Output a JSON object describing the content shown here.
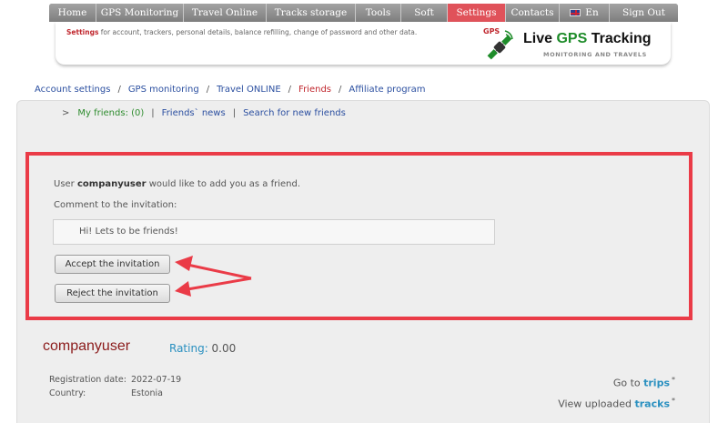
{
  "nav": {
    "items": [
      {
        "label": "Home"
      },
      {
        "label": "GPS Monitoring"
      },
      {
        "label": "Travel Online"
      },
      {
        "label": "Tracks storage"
      },
      {
        "label": "Tools"
      },
      {
        "label": "Soft"
      },
      {
        "label": "Settings"
      },
      {
        "label": "Contacts"
      },
      {
        "label": "En"
      },
      {
        "label": "Sign Out"
      }
    ],
    "active_color": "#e0525a"
  },
  "header": {
    "desc_highlight": "Settings",
    "desc_text": " for account, trackers, personal details, balance refilling, change of password and other data.",
    "logo_mark": "GPS",
    "logo_title_1": "Live ",
    "logo_title_2": "GPS",
    "logo_title_3": " Tracking",
    "logo_sub": "MONITORING AND TRAVELS"
  },
  "breadcrumb": {
    "items": [
      "Account settings",
      "GPS monitoring",
      "Travel ONLINE",
      "Friends",
      "Affiliate program"
    ],
    "sep": "/"
  },
  "subnav": {
    "marker": ">",
    "current": "My friends: (0)",
    "links": [
      "Friends` news",
      "Search for new friends"
    ],
    "sep": "|"
  },
  "invitation": {
    "prefix": "User ",
    "user": "companyuser",
    "suffix": " would like to add you as a friend.",
    "comment_label": "Comment to the invitation:",
    "comment_text": "Hi! Lets to be friends!",
    "accept_label": "Accept the invitation",
    "reject_label": "Reject the invitation",
    "highlight_color": "#ea3b47"
  },
  "profile": {
    "username": "companyuser",
    "rating_label": "Rating:",
    "rating_value": " 0.00",
    "reg_label": "Registration date:",
    "reg_value": "2022-07-19",
    "country_label": "Country:",
    "country_value": "Estonia",
    "goto_prefix": "Go to ",
    "goto_link": "trips",
    "view_prefix": "View uploaded ",
    "view_link": "tracks",
    "asterisk": "*"
  }
}
